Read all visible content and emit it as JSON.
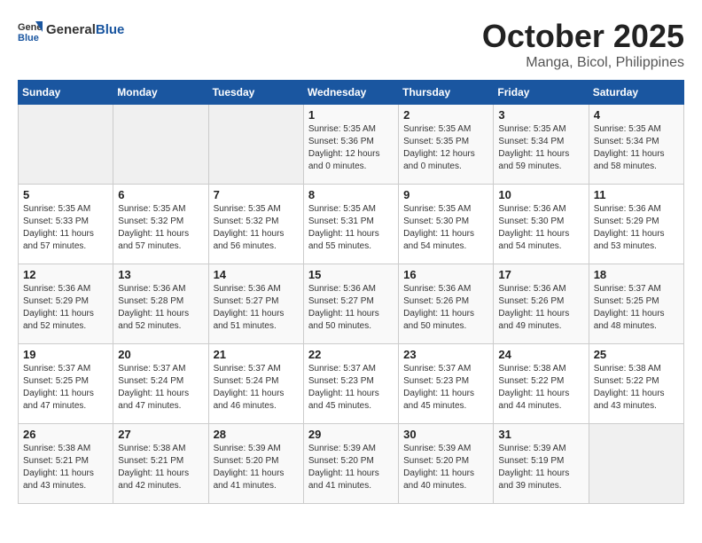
{
  "logo": {
    "general": "General",
    "blue": "Blue"
  },
  "header": {
    "month": "October 2025",
    "location": "Manga, Bicol, Philippines"
  },
  "weekdays": [
    "Sunday",
    "Monday",
    "Tuesday",
    "Wednesday",
    "Thursday",
    "Friday",
    "Saturday"
  ],
  "weeks": [
    [
      {
        "day": "",
        "sunrise": "",
        "sunset": "",
        "daylight": ""
      },
      {
        "day": "",
        "sunrise": "",
        "sunset": "",
        "daylight": ""
      },
      {
        "day": "",
        "sunrise": "",
        "sunset": "",
        "daylight": ""
      },
      {
        "day": "1",
        "sunrise": "Sunrise: 5:35 AM",
        "sunset": "Sunset: 5:36 PM",
        "daylight": "Daylight: 12 hours and 0 minutes."
      },
      {
        "day": "2",
        "sunrise": "Sunrise: 5:35 AM",
        "sunset": "Sunset: 5:35 PM",
        "daylight": "Daylight: 12 hours and 0 minutes."
      },
      {
        "day": "3",
        "sunrise": "Sunrise: 5:35 AM",
        "sunset": "Sunset: 5:34 PM",
        "daylight": "Daylight: 11 hours and 59 minutes."
      },
      {
        "day": "4",
        "sunrise": "Sunrise: 5:35 AM",
        "sunset": "Sunset: 5:34 PM",
        "daylight": "Daylight: 11 hours and 58 minutes."
      }
    ],
    [
      {
        "day": "5",
        "sunrise": "Sunrise: 5:35 AM",
        "sunset": "Sunset: 5:33 PM",
        "daylight": "Daylight: 11 hours and 57 minutes."
      },
      {
        "day": "6",
        "sunrise": "Sunrise: 5:35 AM",
        "sunset": "Sunset: 5:32 PM",
        "daylight": "Daylight: 11 hours and 57 minutes."
      },
      {
        "day": "7",
        "sunrise": "Sunrise: 5:35 AM",
        "sunset": "Sunset: 5:32 PM",
        "daylight": "Daylight: 11 hours and 56 minutes."
      },
      {
        "day": "8",
        "sunrise": "Sunrise: 5:35 AM",
        "sunset": "Sunset: 5:31 PM",
        "daylight": "Daylight: 11 hours and 55 minutes."
      },
      {
        "day": "9",
        "sunrise": "Sunrise: 5:35 AM",
        "sunset": "Sunset: 5:30 PM",
        "daylight": "Daylight: 11 hours and 54 minutes."
      },
      {
        "day": "10",
        "sunrise": "Sunrise: 5:36 AM",
        "sunset": "Sunset: 5:30 PM",
        "daylight": "Daylight: 11 hours and 54 minutes."
      },
      {
        "day": "11",
        "sunrise": "Sunrise: 5:36 AM",
        "sunset": "Sunset: 5:29 PM",
        "daylight": "Daylight: 11 hours and 53 minutes."
      }
    ],
    [
      {
        "day": "12",
        "sunrise": "Sunrise: 5:36 AM",
        "sunset": "Sunset: 5:29 PM",
        "daylight": "Daylight: 11 hours and 52 minutes."
      },
      {
        "day": "13",
        "sunrise": "Sunrise: 5:36 AM",
        "sunset": "Sunset: 5:28 PM",
        "daylight": "Daylight: 11 hours and 52 minutes."
      },
      {
        "day": "14",
        "sunrise": "Sunrise: 5:36 AM",
        "sunset": "Sunset: 5:27 PM",
        "daylight": "Daylight: 11 hours and 51 minutes."
      },
      {
        "day": "15",
        "sunrise": "Sunrise: 5:36 AM",
        "sunset": "Sunset: 5:27 PM",
        "daylight": "Daylight: 11 hours and 50 minutes."
      },
      {
        "day": "16",
        "sunrise": "Sunrise: 5:36 AM",
        "sunset": "Sunset: 5:26 PM",
        "daylight": "Daylight: 11 hours and 50 minutes."
      },
      {
        "day": "17",
        "sunrise": "Sunrise: 5:36 AM",
        "sunset": "Sunset: 5:26 PM",
        "daylight": "Daylight: 11 hours and 49 minutes."
      },
      {
        "day": "18",
        "sunrise": "Sunrise: 5:37 AM",
        "sunset": "Sunset: 5:25 PM",
        "daylight": "Daylight: 11 hours and 48 minutes."
      }
    ],
    [
      {
        "day": "19",
        "sunrise": "Sunrise: 5:37 AM",
        "sunset": "Sunset: 5:25 PM",
        "daylight": "Daylight: 11 hours and 47 minutes."
      },
      {
        "day": "20",
        "sunrise": "Sunrise: 5:37 AM",
        "sunset": "Sunset: 5:24 PM",
        "daylight": "Daylight: 11 hours and 47 minutes."
      },
      {
        "day": "21",
        "sunrise": "Sunrise: 5:37 AM",
        "sunset": "Sunset: 5:24 PM",
        "daylight": "Daylight: 11 hours and 46 minutes."
      },
      {
        "day": "22",
        "sunrise": "Sunrise: 5:37 AM",
        "sunset": "Sunset: 5:23 PM",
        "daylight": "Daylight: 11 hours and 45 minutes."
      },
      {
        "day": "23",
        "sunrise": "Sunrise: 5:37 AM",
        "sunset": "Sunset: 5:23 PM",
        "daylight": "Daylight: 11 hours and 45 minutes."
      },
      {
        "day": "24",
        "sunrise": "Sunrise: 5:38 AM",
        "sunset": "Sunset: 5:22 PM",
        "daylight": "Daylight: 11 hours and 44 minutes."
      },
      {
        "day": "25",
        "sunrise": "Sunrise: 5:38 AM",
        "sunset": "Sunset: 5:22 PM",
        "daylight": "Daylight: 11 hours and 43 minutes."
      }
    ],
    [
      {
        "day": "26",
        "sunrise": "Sunrise: 5:38 AM",
        "sunset": "Sunset: 5:21 PM",
        "daylight": "Daylight: 11 hours and 43 minutes."
      },
      {
        "day": "27",
        "sunrise": "Sunrise: 5:38 AM",
        "sunset": "Sunset: 5:21 PM",
        "daylight": "Daylight: 11 hours and 42 minutes."
      },
      {
        "day": "28",
        "sunrise": "Sunrise: 5:39 AM",
        "sunset": "Sunset: 5:20 PM",
        "daylight": "Daylight: 11 hours and 41 minutes."
      },
      {
        "day": "29",
        "sunrise": "Sunrise: 5:39 AM",
        "sunset": "Sunset: 5:20 PM",
        "daylight": "Daylight: 11 hours and 41 minutes."
      },
      {
        "day": "30",
        "sunrise": "Sunrise: 5:39 AM",
        "sunset": "Sunset: 5:20 PM",
        "daylight": "Daylight: 11 hours and 40 minutes."
      },
      {
        "day": "31",
        "sunrise": "Sunrise: 5:39 AM",
        "sunset": "Sunset: 5:19 PM",
        "daylight": "Daylight: 11 hours and 39 minutes."
      },
      {
        "day": "",
        "sunrise": "",
        "sunset": "",
        "daylight": ""
      }
    ]
  ]
}
